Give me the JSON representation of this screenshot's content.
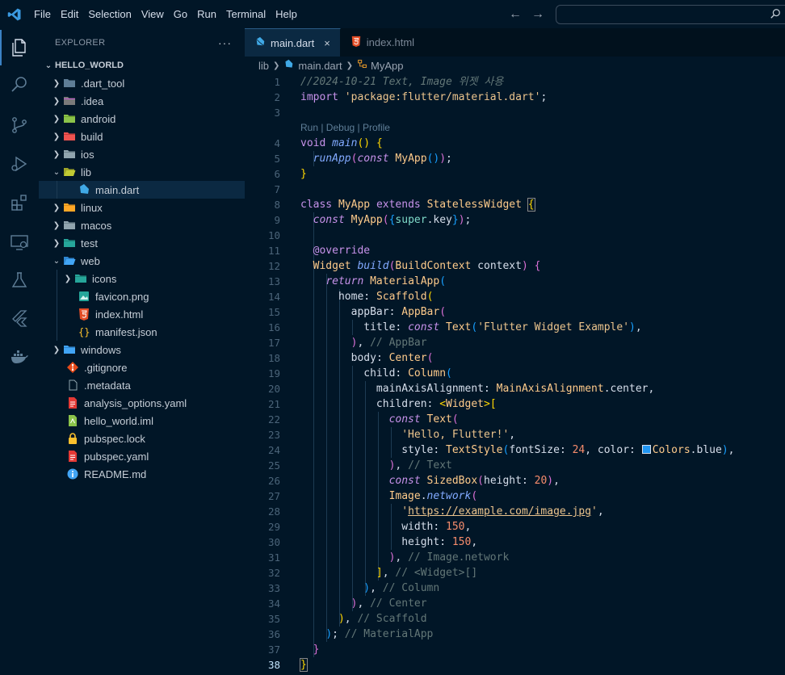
{
  "menu": [
    "File",
    "Edit",
    "Selection",
    "View",
    "Go",
    "Run",
    "Terminal",
    "Help"
  ],
  "search": {
    "placeholder": ""
  },
  "explorer": {
    "title": "EXPLORER",
    "more": "···",
    "root": "HELLO_WORLD",
    "items": [
      {
        "label": ".dart_tool",
        "type": "folder",
        "depth": 1,
        "expanded": false,
        "icon": "folder-dart-icon"
      },
      {
        "label": ".idea",
        "type": "folder",
        "depth": 1,
        "expanded": false,
        "icon": "folder-idea-icon"
      },
      {
        "label": "android",
        "type": "folder",
        "depth": 1,
        "expanded": false,
        "icon": "folder-android-icon"
      },
      {
        "label": "build",
        "type": "folder",
        "depth": 1,
        "expanded": false,
        "icon": "folder-build-icon"
      },
      {
        "label": "ios",
        "type": "folder",
        "depth": 1,
        "expanded": false,
        "icon": "folder-ios-icon"
      },
      {
        "label": "lib",
        "type": "folder",
        "depth": 1,
        "expanded": true,
        "icon": "folder-lib-icon"
      },
      {
        "label": "main.dart",
        "type": "file",
        "depth": 2,
        "selected": true,
        "icon": "dart-file-icon"
      },
      {
        "label": "linux",
        "type": "folder",
        "depth": 1,
        "expanded": false,
        "icon": "folder-linux-icon"
      },
      {
        "label": "macos",
        "type": "folder",
        "depth": 1,
        "expanded": false,
        "icon": "folder-macos-icon"
      },
      {
        "label": "test",
        "type": "folder",
        "depth": 1,
        "expanded": false,
        "icon": "folder-test-icon"
      },
      {
        "label": "web",
        "type": "folder",
        "depth": 1,
        "expanded": true,
        "icon": "folder-web-icon"
      },
      {
        "label": "icons",
        "type": "folder",
        "depth": 2,
        "expanded": false,
        "icon": "folder-images-icon"
      },
      {
        "label": "favicon.png",
        "type": "file",
        "depth": 2,
        "icon": "image-file-icon"
      },
      {
        "label": "index.html",
        "type": "file",
        "depth": 2,
        "icon": "html-file-icon"
      },
      {
        "label": "manifest.json",
        "type": "file",
        "depth": 2,
        "icon": "json-file-icon"
      },
      {
        "label": "windows",
        "type": "folder",
        "depth": 1,
        "expanded": false,
        "icon": "folder-windows-icon"
      },
      {
        "label": ".gitignore",
        "type": "file",
        "depth": 1,
        "icon": "git-file-icon"
      },
      {
        "label": ".metadata",
        "type": "file",
        "depth": 1,
        "icon": "plain-file-icon"
      },
      {
        "label": "analysis_options.yaml",
        "type": "file",
        "depth": 1,
        "icon": "yaml-file-icon"
      },
      {
        "label": "hello_world.iml",
        "type": "file",
        "depth": 1,
        "icon": "iml-file-icon"
      },
      {
        "label": "pubspec.lock",
        "type": "file",
        "depth": 1,
        "icon": "lock-file-icon"
      },
      {
        "label": "pubspec.yaml",
        "type": "file",
        "depth": 1,
        "icon": "yaml-file-icon"
      },
      {
        "label": "README.md",
        "type": "file",
        "depth": 1,
        "icon": "info-file-icon"
      }
    ]
  },
  "tabs": [
    {
      "label": "main.dart",
      "active": true,
      "icon": "dart-file-icon",
      "close": "×"
    },
    {
      "label": "index.html",
      "active": false,
      "icon": "html-file-icon"
    }
  ],
  "breadcrumb": {
    "folder": "lib",
    "file": "main.dart",
    "symbol": "MyApp"
  },
  "codelens": "Run | Debug | Profile",
  "current_line": 38,
  "line_numbers": [
    "1",
    "2",
    "3",
    "4",
    "5",
    "6",
    "7",
    "8",
    "9",
    "10",
    "11",
    "12",
    "13",
    "14",
    "15",
    "16",
    "17",
    "18",
    "19",
    "20",
    "21",
    "22",
    "23",
    "24",
    "25",
    "26",
    "27",
    "28",
    "29",
    "30",
    "31",
    "32",
    "33",
    "34",
    "35",
    "36",
    "37",
    "38"
  ],
  "code": {
    "l1": "//2024-10-21 Text, Image 위젯 사용",
    "l2_kw": "import",
    "l2_str": "'package:flutter/material.dart'",
    "l2_end": ";",
    "l4_kw": "void",
    "l4_fn": "main",
    "l5_fn": "runApp",
    "l5_const": "const",
    "l5_cls": "MyApp",
    "l8_class": "class",
    "l8_name": "MyApp",
    "l8_extends": "extends",
    "l8_base": "StatelessWidget",
    "l9_const": "const",
    "l9_cls": "MyApp",
    "l9_super": "super",
    "l9_key": "key",
    "l11": "@override",
    "l12_cls": "Widget",
    "l12_fn": "build",
    "l12_type": "BuildContext",
    "l12_param": "context",
    "l13_kw": "return",
    "l13_cls": "MaterialApp",
    "l14_prop": "home",
    "l14_cls": "Scaffold",
    "l15_prop": "appBar",
    "l15_cls": "AppBar",
    "l16_prop": "title",
    "l16_const": "const",
    "l16_cls": "Text",
    "l16_str": "'Flutter Widget Example'",
    "l17_cm": "// AppBar",
    "l18_prop": "body",
    "l18_cls": "Center",
    "l19_prop": "child",
    "l19_cls": "Column",
    "l20_prop": "mainAxisAlignment",
    "l20_cls": "MainAxisAlignment",
    "l20_val": "center",
    "l21_prop": "children",
    "l21_cls": "Widget",
    "l22_const": "const",
    "l22_cls": "Text",
    "l23_str": "'Hello, Flutter!'",
    "l24_prop": "style",
    "l24_cls": "TextStyle",
    "l24_fs": "fontSize",
    "l24_num": "24",
    "l24_color": "color",
    "l24_colcls": "Colors",
    "l24_blue": "blue",
    "l25_cm": "// Text",
    "l26_const": "const",
    "l26_cls": "SizedBox",
    "l26_prop": "height",
    "l26_num": "20",
    "l27_cls": "Image",
    "l27_fn": "network",
    "l28_url": "https://example.com/image.jpg",
    "l29_prop": "width",
    "l29_num": "150",
    "l30_prop": "height",
    "l30_num": "150",
    "l31_cm": "// Image.network",
    "l32_cm": "// <Widget>[]",
    "l33_cm": "// Column",
    "l34_cm": "// Center",
    "l35_cm": "// Scaffold",
    "l36_cm": "// MaterialApp"
  },
  "colors": {
    "background": "#011627",
    "accent": "#3b82c4",
    "swatch": "#2196f3"
  }
}
